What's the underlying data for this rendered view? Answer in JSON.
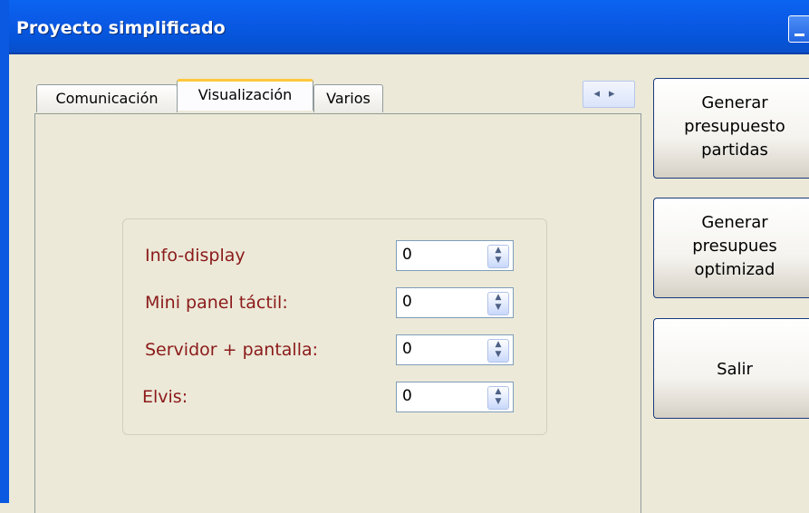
{
  "window": {
    "title": "Proyecto simplificado"
  },
  "tabs": [
    {
      "label": "Comunicación",
      "active": false
    },
    {
      "label": "Visualización",
      "active": true
    },
    {
      "label": "Varios",
      "active": false
    }
  ],
  "tab_scroll": {
    "left": "◂",
    "right": "▸"
  },
  "fields": [
    {
      "label": "Info-display",
      "value": "0"
    },
    {
      "label": "Mini panel táctil:",
      "value": "0"
    },
    {
      "label": "Servidor + pantalla:",
      "value": "0"
    },
    {
      "label": "Elvis:",
      "value": "0"
    }
  ],
  "buttons": {
    "generate_budget": {
      "line1": "Generar",
      "line2": "presupuesto",
      "line3": "partidas"
    },
    "generate_optimized": {
      "line1": "Generar",
      "line2": "presupues",
      "line3": "optimizad"
    },
    "exit": {
      "label": "Salir"
    }
  },
  "colors": {
    "title_bar": "#0a5ae6",
    "label_text": "#8b1a1a",
    "active_tab_accent": "#ffc83c"
  }
}
